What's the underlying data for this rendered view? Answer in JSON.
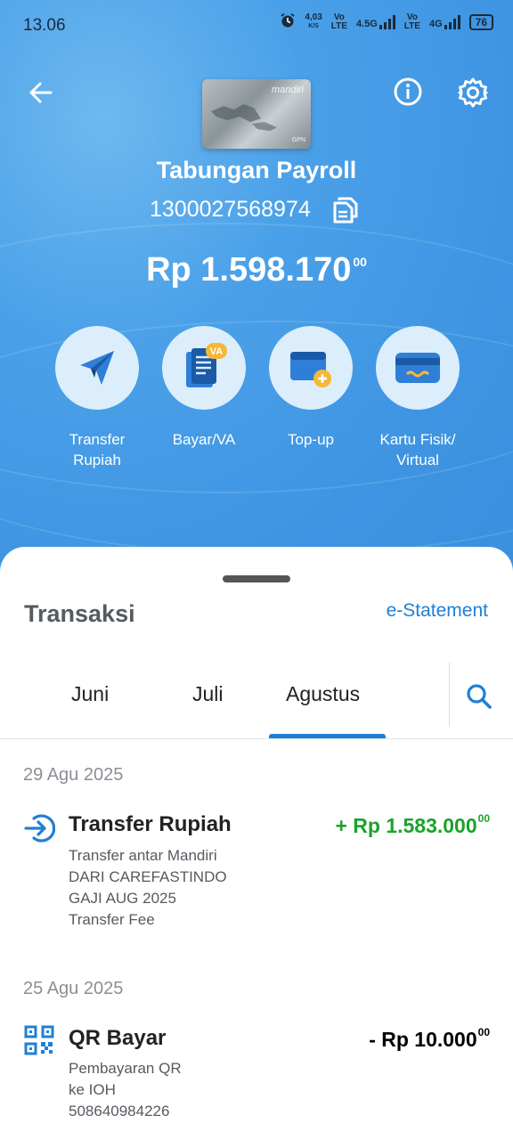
{
  "status_bar": {
    "time": "13.06",
    "speed_value": "4,03",
    "speed_unit": "K/S",
    "sim1_top": "Vo",
    "sim1_bottom": "LTE",
    "sim1_net": "4.5G",
    "sim2_top": "Vo",
    "sim2_bottom": "LTE",
    "sim2_net": "4G",
    "battery": "76"
  },
  "header": {
    "card_brand": "mandiri",
    "card_network": "GPN",
    "account_name": "Tabungan Payroll",
    "account_number": "1300027568974",
    "balance_main": "Rp 1.598.170",
    "balance_cents": "00"
  },
  "actions": [
    {
      "label_line1": "Transfer",
      "label_line2": "Rupiah",
      "icon": "paper-plane-icon"
    },
    {
      "label_line1": "Bayar/VA",
      "label_line2": "",
      "icon": "va-bill-icon"
    },
    {
      "label_line1": "Top-up",
      "label_line2": "",
      "icon": "wallet-topup-icon"
    },
    {
      "label_line1": "Kartu Fisik/",
      "label_line2": "Virtual",
      "icon": "card-icon"
    }
  ],
  "transactions_panel": {
    "title": "Transaksi",
    "estatement": "e-Statement",
    "tabs": [
      "Juni",
      "Juli",
      "Agustus"
    ],
    "active_tab": "Agustus"
  },
  "transactions": [
    {
      "date": "29 Agu 2025",
      "name": "Transfer Rupiah",
      "amount": "+ Rp 1.583.000",
      "amount_cents": "00",
      "amount_color": "#1aa32a",
      "desc": [
        "Transfer antar Mandiri",
        "DARI CAREFASTINDO",
        "GAJI AUG 2025",
        "Transfer Fee"
      ],
      "icon": "incoming-arrow-icon"
    },
    {
      "date": "25 Agu 2025",
      "name": "QR Bayar",
      "amount": "- Rp 10.000",
      "amount_cents": "00",
      "amount_color": "#222222",
      "desc": [
        "Pembayaran QR",
        "ke IOH",
        "508640984226"
      ],
      "icon": "qr-code-icon"
    }
  ]
}
